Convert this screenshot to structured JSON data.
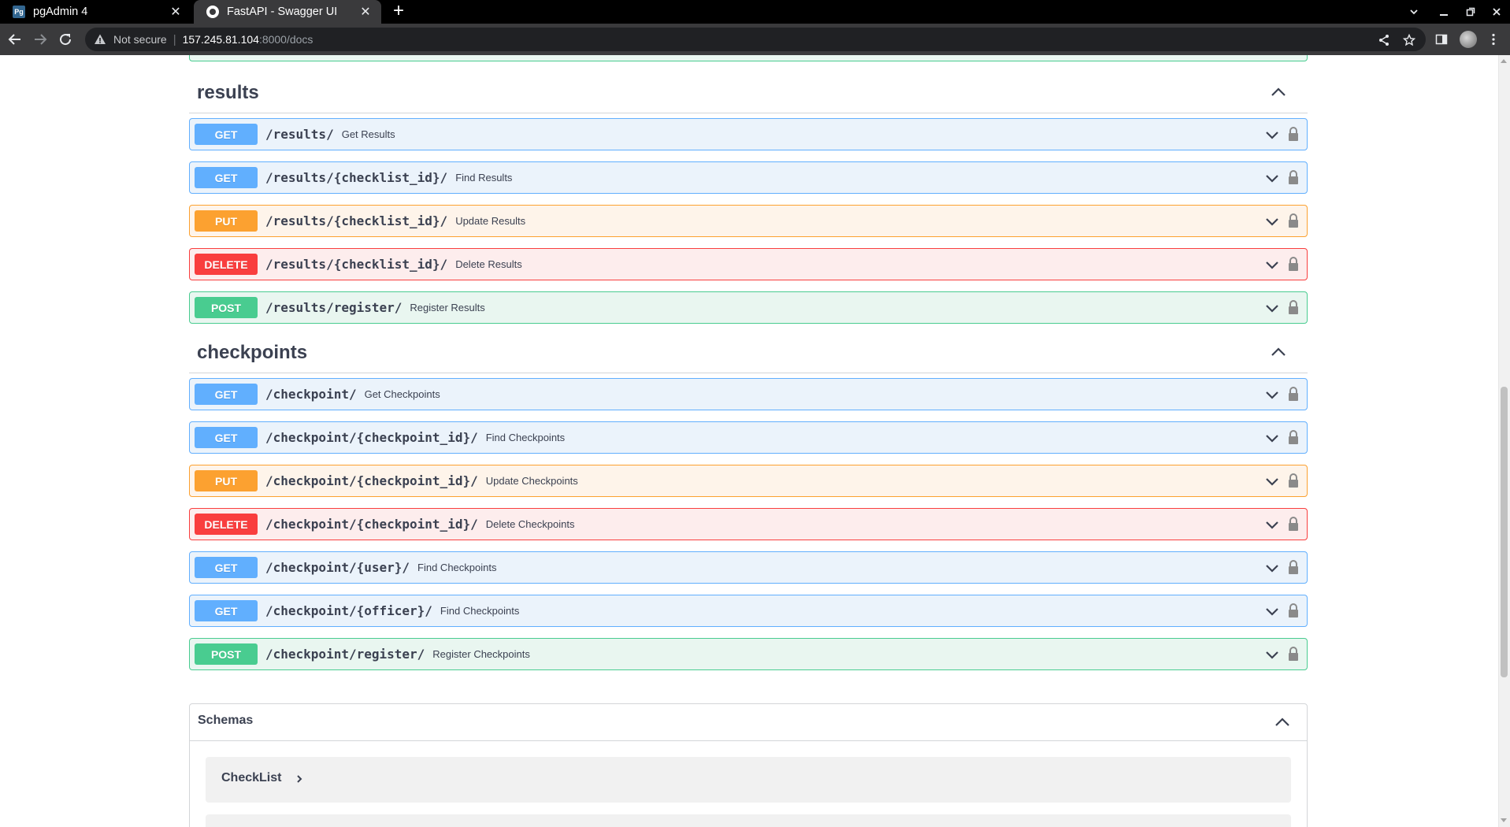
{
  "browser": {
    "tabs": [
      {
        "title": "pgAdmin 4",
        "favicon": "Pg",
        "active": false
      },
      {
        "title": "FastAPI - Swagger UI",
        "active": true
      }
    ],
    "address": {
      "security_label": "Not secure",
      "url_host": "157.245.81.104",
      "url_rest": ":8000/docs"
    }
  },
  "sections": [
    {
      "tag": "results",
      "operations": [
        {
          "method": "GET",
          "path": "/results/",
          "summary": "Get Results"
        },
        {
          "method": "GET",
          "path": "/results/{checklist_id}/",
          "summary": "Find Results"
        },
        {
          "method": "PUT",
          "path": "/results/{checklist_id}/",
          "summary": "Update Results"
        },
        {
          "method": "DELETE",
          "path": "/results/{checklist_id}/",
          "summary": "Delete Results"
        },
        {
          "method": "POST",
          "path": "/results/register/",
          "summary": "Register Results"
        }
      ]
    },
    {
      "tag": "checkpoints",
      "operations": [
        {
          "method": "GET",
          "path": "/checkpoint/",
          "summary": "Get Checkpoints"
        },
        {
          "method": "GET",
          "path": "/checkpoint/{checkpoint_id}/",
          "summary": "Find Checkpoints"
        },
        {
          "method": "PUT",
          "path": "/checkpoint/{checkpoint_id}/",
          "summary": "Update Checkpoints"
        },
        {
          "method": "DELETE",
          "path": "/checkpoint/{checkpoint_id}/",
          "summary": "Delete Checkpoints"
        },
        {
          "method": "GET",
          "path": "/checkpoint/{user}/",
          "summary": "Find Checkpoints"
        },
        {
          "method": "GET",
          "path": "/checkpoint/{officer}/",
          "summary": "Find Checkpoints"
        },
        {
          "method": "POST",
          "path": "/checkpoint/register/",
          "summary": "Register Checkpoints"
        }
      ]
    }
  ],
  "schemas": {
    "title": "Schemas",
    "models": [
      {
        "name": "CheckList"
      }
    ]
  },
  "colors": {
    "get": "#61affe",
    "put": "#fca130",
    "delete": "#f93e3e",
    "post": "#49cc90",
    "text": "#3b4151"
  }
}
